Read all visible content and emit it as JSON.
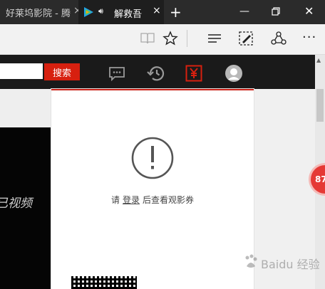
{
  "tabs": [
    {
      "title": "好莱坞影院 - 腾",
      "active": false
    },
    {
      "title": "解救吾",
      "active": true
    }
  ],
  "toolbar": {
    "icons": [
      "reading-view-icon",
      "favorite-star-icon",
      "hub-icon",
      "web-note-icon",
      "share-icon",
      "more-icon"
    ]
  },
  "site_header": {
    "search_value": "",
    "search_button": "搜索",
    "icons": [
      "message-icon",
      "history-icon",
      "coupon-yen-icon",
      "user-avatar-icon"
    ]
  },
  "popup": {
    "prefix": "请",
    "login_link": "登录",
    "suffix": "后查看观影券"
  },
  "video": {
    "overlay_text": "已视频"
  },
  "badge": {
    "text": "87"
  },
  "watermark": {
    "text": "Baidu 经验"
  },
  "colors": {
    "accent": "#d7200f",
    "header_bg": "#1a1a1a",
    "tabbar_bg": "#2b2b2b"
  }
}
